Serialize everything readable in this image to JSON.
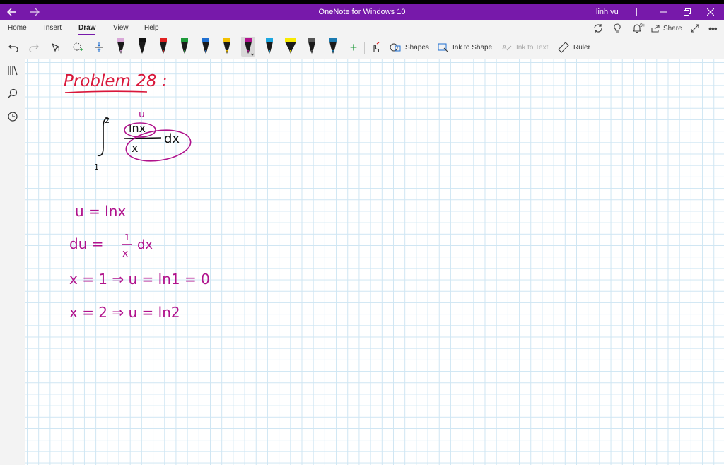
{
  "window": {
    "title": "OneNote for Windows 10",
    "user": "linh vu"
  },
  "menu": {
    "items": [
      {
        "label": "Home",
        "active": false
      },
      {
        "label": "Insert",
        "active": false
      },
      {
        "label": "Draw",
        "active": true
      },
      {
        "label": "View",
        "active": false
      },
      {
        "label": "Help",
        "active": false
      }
    ],
    "share_label": "Share",
    "notifications_badge": "9+"
  },
  "toolbar": {
    "shapes_label": "Shapes",
    "ink_to_shape_label": "Ink to Shape",
    "ink_to_text_label": "Ink to Text",
    "ruler_label": "Ruler",
    "pens": [
      {
        "name": "pencil-lavender",
        "color": "#d9a8d8"
      },
      {
        "name": "pen-black",
        "color": "#111111"
      },
      {
        "name": "pen-red",
        "color": "#e02020"
      },
      {
        "name": "pen-green",
        "color": "#1e9a3a"
      },
      {
        "name": "pen-blue",
        "color": "#1f6fd1"
      },
      {
        "name": "pen-yellow",
        "color": "#f2c000"
      },
      {
        "name": "pen-magenta",
        "color": "#b0128c"
      },
      {
        "name": "pen-cyan",
        "color": "#1ba7e0"
      },
      {
        "name": "highlighter-yellow",
        "color": "#f7ea00"
      },
      {
        "name": "pen-gray",
        "color": "#555555"
      },
      {
        "name": "pen-teal",
        "color": "#1a7ab0"
      }
    ],
    "selected_pen_index": 6
  },
  "notes": {
    "heading": "Problem 28 :",
    "integral": {
      "upper": "2",
      "lower": "1",
      "numerator": "lnx",
      "denominator": "x",
      "differential": "dx",
      "u_marker": "u"
    },
    "lines": [
      "u = lnx",
      "du = 1/x dx",
      "x = 1 ⇒ u = ln1 = 0",
      "x = 2 ⇒ u = ln2"
    ],
    "du_eq": {
      "lhs": "du =",
      "num": "1",
      "den": "x",
      "rhs": "dx"
    }
  },
  "colors": {
    "accent": "#7719aa",
    "ink_red": "#d9173a",
    "ink_magenta": "#b0128c",
    "ink_black": "#111111",
    "grid": "#cfe6f3"
  }
}
